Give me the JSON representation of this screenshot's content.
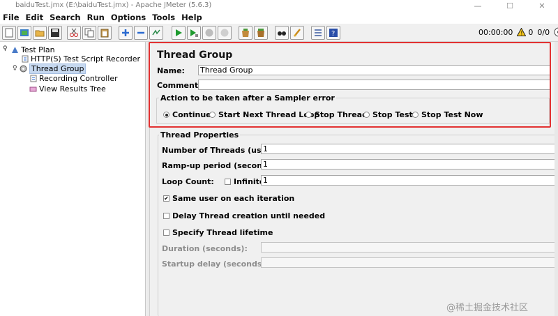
{
  "window": {
    "title": "baiduTest.jmx (E:\\baiduTest.jmx) - Apache JMeter (5.6.3)",
    "controls": [
      "—",
      "☐",
      "✕"
    ]
  },
  "menu": [
    "File",
    "Edit",
    "Search",
    "Run",
    "Options",
    "Tools",
    "Help"
  ],
  "toolbar": {
    "timer": "00:00:00",
    "warnings": "0",
    "threads": "0/0",
    "icons": [
      "new-icon",
      "templates-icon",
      "open-icon",
      "save-icon",
      "cut-icon",
      "copy-icon",
      "paste-icon",
      "expand-icon",
      "collapse-icon",
      "toggle-icon",
      "start-icon",
      "start-no-pause-icon",
      "stop-icon",
      "shutdown-icon",
      "clear-icon",
      "clear-all-icon",
      "search-icon",
      "reset-search-icon",
      "function-helper-icon",
      "help-icon"
    ]
  },
  "tree": {
    "items": [
      {
        "label": "Test Plan",
        "icon": "test-plan-icon",
        "selected": false
      },
      {
        "label": "HTTP(S) Test Script Recorder",
        "icon": "recorder-icon",
        "selected": false
      },
      {
        "label": "Thread Group",
        "icon": "thread-group-icon",
        "selected": true
      },
      {
        "label": "Recording Controller",
        "icon": "controller-icon",
        "selected": false
      },
      {
        "label": "View Results Tree",
        "icon": "listener-icon",
        "selected": false
      }
    ]
  },
  "panel": {
    "title": "Thread Group",
    "name_label": "Name:",
    "name_value": "Thread Group",
    "comments_label": "Comments:",
    "comments_value": "",
    "error_action": {
      "title": "Action to be taken after a Sampler error",
      "options": [
        "Continue",
        "Start Next Thread Loop",
        "Stop Thread",
        "Stop Test",
        "Stop Test Now"
      ],
      "selected": "Continue"
    },
    "thread_props": {
      "title": "Thread Properties",
      "num_threads_label": "Number of Threads (users):",
      "num_threads_value": "1",
      "rampup_label": "Ramp-up period (seconds):",
      "rampup_value": "1",
      "loop_label": "Loop Count:",
      "infinite_label": "Infinite",
      "infinite_checked": false,
      "loop_value": "1",
      "same_user_label": "Same user on each iteration",
      "same_user_checked": true,
      "delay_label": "Delay Thread creation until needed",
      "delay_checked": false,
      "lifetime_label": "Specify Thread lifetime",
      "lifetime_checked": false,
      "duration_label": "Duration (seconds):",
      "duration_value": "",
      "startup_label": "Startup delay (seconds):",
      "startup_value": ""
    }
  },
  "watermark": "@稀土掘金技术社区",
  "colors": {
    "highlight": "#e23232",
    "selection": "#c6d8ef"
  }
}
